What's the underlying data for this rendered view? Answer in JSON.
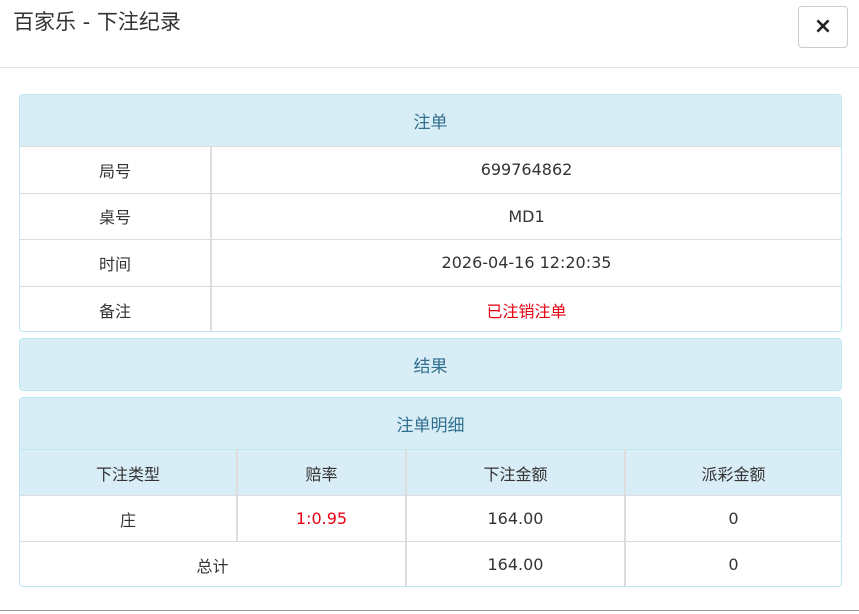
{
  "header": {
    "title": "百家乐 - 下注纪录",
    "close_icon": "×"
  },
  "bet_panel": {
    "heading": "注单",
    "rows": [
      {
        "label": "局号",
        "value": "699764862"
      },
      {
        "label": "桌号",
        "value": "MD1"
      },
      {
        "label": "时间",
        "value": "2026-04-16 12:20:35"
      },
      {
        "label": "备注",
        "value": "已注销注单"
      }
    ]
  },
  "result_panel": {
    "heading": "结果"
  },
  "detail_panel": {
    "heading": "注单明细",
    "columns": [
      "下注类型",
      "赔率",
      "下注金额",
      "派彩金额"
    ],
    "rows": [
      {
        "type": "庄",
        "odds": "1:0.95",
        "amount": "164.00",
        "payout": "0"
      }
    ],
    "total": {
      "label": "总计",
      "amount": "164.00",
      "payout": "0"
    }
  },
  "colors": {
    "panel_heading_bg": "#d9edf7",
    "panel_heading_text": "#31708f",
    "alert_red": "#e60012"
  }
}
